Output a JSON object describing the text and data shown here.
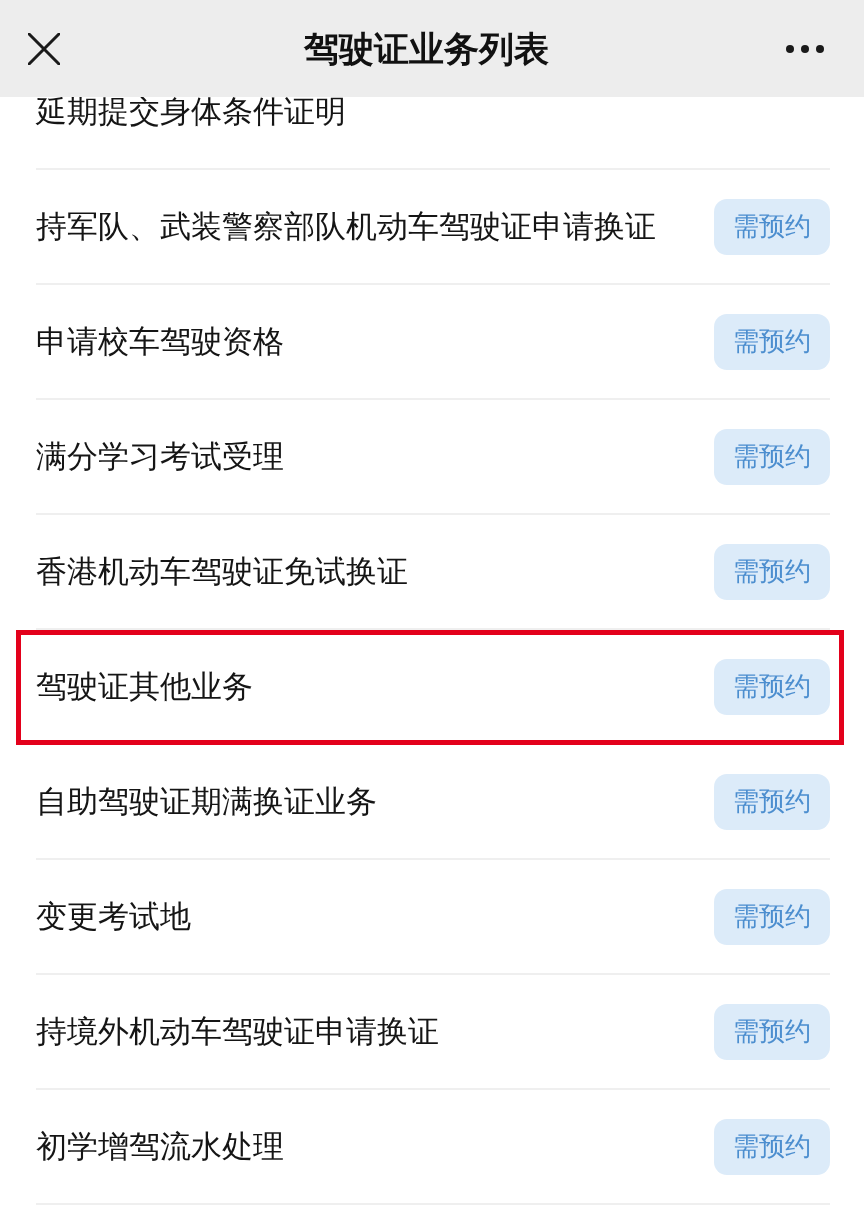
{
  "header": {
    "title": "驾驶证业务列表"
  },
  "items": [
    {
      "name": "延期提交身体条件证明",
      "highlighted": false
    },
    {
      "name": "持军队、武装警察部队机动车驾驶证申请换证",
      "badge": "需预约",
      "highlighted": false
    },
    {
      "name": "申请校车驾驶资格",
      "badge": "需预约",
      "highlighted": false
    },
    {
      "name": "满分学习考试受理",
      "badge": "需预约",
      "highlighted": false
    },
    {
      "name": "香港机动车驾驶证免试换证",
      "badge": "需预约",
      "highlighted": false
    },
    {
      "name": "驾驶证其他业务",
      "badge": "需预约",
      "highlighted": true
    },
    {
      "name": "自助驾驶证期满换证业务",
      "badge": "需预约",
      "highlighted": false
    },
    {
      "name": "变更考试地",
      "badge": "需预约",
      "highlighted": false
    },
    {
      "name": "持境外机动车驾驶证申请换证",
      "badge": "需预约",
      "highlighted": false
    },
    {
      "name": "初学增驾流水处理",
      "badge": "需预约",
      "highlighted": false
    }
  ]
}
